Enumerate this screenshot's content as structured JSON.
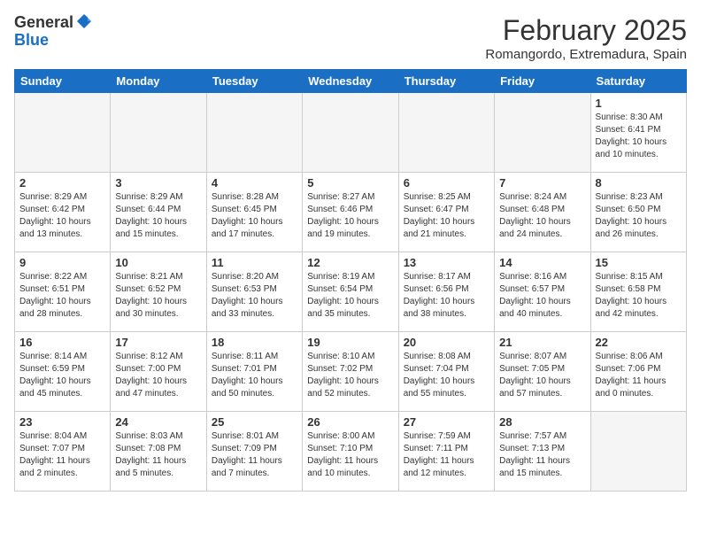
{
  "header": {
    "logo": {
      "line1": "General",
      "line2": "Blue"
    },
    "month": "February 2025",
    "location": "Romangordo, Extremadura, Spain"
  },
  "days_of_week": [
    "Sunday",
    "Monday",
    "Tuesday",
    "Wednesday",
    "Thursday",
    "Friday",
    "Saturday"
  ],
  "weeks": [
    [
      {
        "day": "",
        "info": ""
      },
      {
        "day": "",
        "info": ""
      },
      {
        "day": "",
        "info": ""
      },
      {
        "day": "",
        "info": ""
      },
      {
        "day": "",
        "info": ""
      },
      {
        "day": "",
        "info": ""
      },
      {
        "day": "1",
        "info": "Sunrise: 8:30 AM\nSunset: 6:41 PM\nDaylight: 10 hours\nand 10 minutes."
      }
    ],
    [
      {
        "day": "2",
        "info": "Sunrise: 8:29 AM\nSunset: 6:42 PM\nDaylight: 10 hours\nand 13 minutes."
      },
      {
        "day": "3",
        "info": "Sunrise: 8:29 AM\nSunset: 6:44 PM\nDaylight: 10 hours\nand 15 minutes."
      },
      {
        "day": "4",
        "info": "Sunrise: 8:28 AM\nSunset: 6:45 PM\nDaylight: 10 hours\nand 17 minutes."
      },
      {
        "day": "5",
        "info": "Sunrise: 8:27 AM\nSunset: 6:46 PM\nDaylight: 10 hours\nand 19 minutes."
      },
      {
        "day": "6",
        "info": "Sunrise: 8:25 AM\nSunset: 6:47 PM\nDaylight: 10 hours\nand 21 minutes."
      },
      {
        "day": "7",
        "info": "Sunrise: 8:24 AM\nSunset: 6:48 PM\nDaylight: 10 hours\nand 24 minutes."
      },
      {
        "day": "8",
        "info": "Sunrise: 8:23 AM\nSunset: 6:50 PM\nDaylight: 10 hours\nand 26 minutes."
      }
    ],
    [
      {
        "day": "9",
        "info": "Sunrise: 8:22 AM\nSunset: 6:51 PM\nDaylight: 10 hours\nand 28 minutes."
      },
      {
        "day": "10",
        "info": "Sunrise: 8:21 AM\nSunset: 6:52 PM\nDaylight: 10 hours\nand 30 minutes."
      },
      {
        "day": "11",
        "info": "Sunrise: 8:20 AM\nSunset: 6:53 PM\nDaylight: 10 hours\nand 33 minutes."
      },
      {
        "day": "12",
        "info": "Sunrise: 8:19 AM\nSunset: 6:54 PM\nDaylight: 10 hours\nand 35 minutes."
      },
      {
        "day": "13",
        "info": "Sunrise: 8:17 AM\nSunset: 6:56 PM\nDaylight: 10 hours\nand 38 minutes."
      },
      {
        "day": "14",
        "info": "Sunrise: 8:16 AM\nSunset: 6:57 PM\nDaylight: 10 hours\nand 40 minutes."
      },
      {
        "day": "15",
        "info": "Sunrise: 8:15 AM\nSunset: 6:58 PM\nDaylight: 10 hours\nand 42 minutes."
      }
    ],
    [
      {
        "day": "16",
        "info": "Sunrise: 8:14 AM\nSunset: 6:59 PM\nDaylight: 10 hours\nand 45 minutes."
      },
      {
        "day": "17",
        "info": "Sunrise: 8:12 AM\nSunset: 7:00 PM\nDaylight: 10 hours\nand 47 minutes."
      },
      {
        "day": "18",
        "info": "Sunrise: 8:11 AM\nSunset: 7:01 PM\nDaylight: 10 hours\nand 50 minutes."
      },
      {
        "day": "19",
        "info": "Sunrise: 8:10 AM\nSunset: 7:02 PM\nDaylight: 10 hours\nand 52 minutes."
      },
      {
        "day": "20",
        "info": "Sunrise: 8:08 AM\nSunset: 7:04 PM\nDaylight: 10 hours\nand 55 minutes."
      },
      {
        "day": "21",
        "info": "Sunrise: 8:07 AM\nSunset: 7:05 PM\nDaylight: 10 hours\nand 57 minutes."
      },
      {
        "day": "22",
        "info": "Sunrise: 8:06 AM\nSunset: 7:06 PM\nDaylight: 11 hours\nand 0 minutes."
      }
    ],
    [
      {
        "day": "23",
        "info": "Sunrise: 8:04 AM\nSunset: 7:07 PM\nDaylight: 11 hours\nand 2 minutes."
      },
      {
        "day": "24",
        "info": "Sunrise: 8:03 AM\nSunset: 7:08 PM\nDaylight: 11 hours\nand 5 minutes."
      },
      {
        "day": "25",
        "info": "Sunrise: 8:01 AM\nSunset: 7:09 PM\nDaylight: 11 hours\nand 7 minutes."
      },
      {
        "day": "26",
        "info": "Sunrise: 8:00 AM\nSunset: 7:10 PM\nDaylight: 11 hours\nand 10 minutes."
      },
      {
        "day": "27",
        "info": "Sunrise: 7:59 AM\nSunset: 7:11 PM\nDaylight: 11 hours\nand 12 minutes."
      },
      {
        "day": "28",
        "info": "Sunrise: 7:57 AM\nSunset: 7:13 PM\nDaylight: 11 hours\nand 15 minutes."
      },
      {
        "day": "",
        "info": ""
      }
    ]
  ]
}
